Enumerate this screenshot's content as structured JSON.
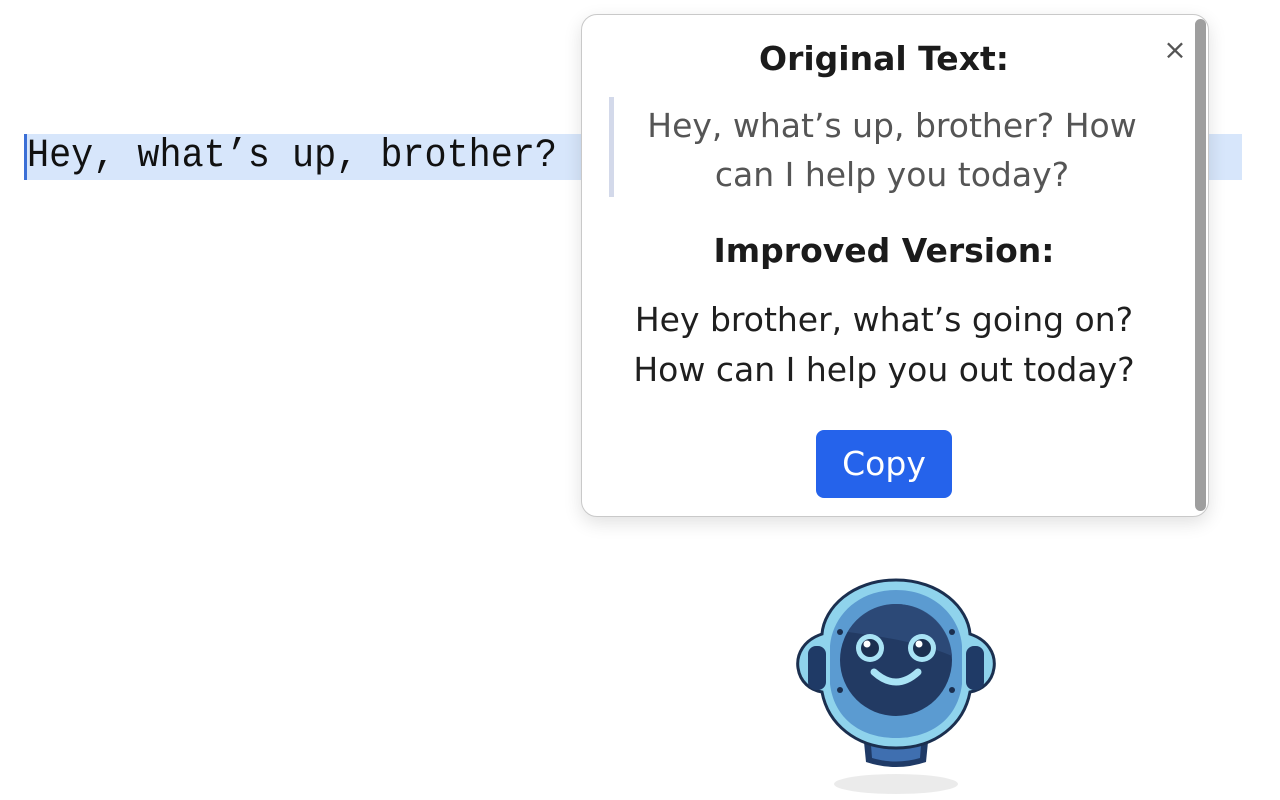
{
  "editor": {
    "selected_text": "Hey, what’s up, brother? How can I help you today?"
  },
  "popup": {
    "close_label": "×",
    "original_title": "Original Text:",
    "original_text": "Hey, what’s up, brother? How can I help you today?",
    "improved_title": "Improved Version:",
    "improved_text": "Hey brother, what’s going on? How can I help you out today?",
    "copy_label": "Copy"
  },
  "mascot": {
    "icon": "robot-icon"
  },
  "colors": {
    "selection": "#d7e6fb",
    "accent": "#2563eb",
    "quote_border": "#d3d9ea"
  }
}
